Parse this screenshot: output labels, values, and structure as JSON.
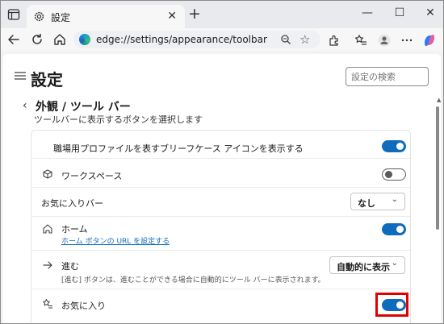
{
  "browser": {
    "tab_title": "設定",
    "tab_close": "✕",
    "new_tab": "+",
    "window_controls": {
      "minimize": "—",
      "maximize": "☐",
      "close": "✕"
    },
    "address_url": "edge://settings/appearance/toolbar",
    "icons": [
      "window-menu-icon",
      "gear-icon",
      "back-icon",
      "refresh-icon",
      "home-icon",
      "edge-logo-icon",
      "zoom-icon",
      "favorite-star-icon",
      "extensions-icon",
      "favorites-icon",
      "profile-icon",
      "more-icon",
      "copilot-icon"
    ]
  },
  "page": {
    "title": "設定",
    "search_placeholder": "設定の検索",
    "section": {
      "back": "‹",
      "title": "外観 / ツール バー",
      "description": "ツールバーに表示するボタンを選択します"
    },
    "settings": [
      {
        "label": "職場用プロファイルを表すブリーフケース アイコンを表示する",
        "control": "toggle",
        "state": "on"
      },
      {
        "label": "ワークスペース",
        "icon": "workspaces-icon",
        "control": "toggle",
        "state": "off"
      },
      {
        "label": "お気に入りバー",
        "control": "dropdown",
        "value": "なし"
      },
      {
        "label": "ホーム",
        "icon": "home-icon",
        "link": "ホーム ボタンの URL を設定する",
        "control": "toggle",
        "state": "on"
      },
      {
        "label": "進む",
        "icon": "forward-arrow-icon",
        "sub": "[進む] ボタンは、進むことができる場合に自動的にツール バーに表示されます。",
        "control": "dropdown",
        "value": "自動的に表示"
      },
      {
        "label": "お気に入り",
        "icon": "favorites-icon",
        "control": "toggle",
        "state": "on",
        "highlighted": true
      }
    ]
  },
  "colors": {
    "accent": "#0f6cbd",
    "highlight": "#e00000"
  }
}
